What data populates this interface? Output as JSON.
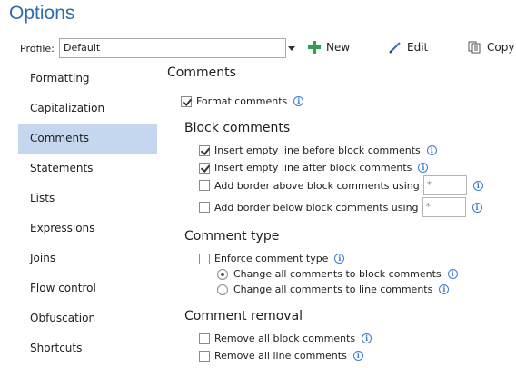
{
  "window": {
    "title": "Options"
  },
  "profile": {
    "label": "Profile:",
    "value": "Default"
  },
  "toolbar": {
    "new_label": "New",
    "edit_label": "Edit",
    "copy_label": "Copy"
  },
  "nav": {
    "items": [
      {
        "label": "Formatting"
      },
      {
        "label": "Capitalization"
      },
      {
        "label": "Comments",
        "selected": true
      },
      {
        "label": "Statements"
      },
      {
        "label": "Lists"
      },
      {
        "label": "Expressions"
      },
      {
        "label": "Joins"
      },
      {
        "label": "Flow control"
      },
      {
        "label": "Obfuscation"
      },
      {
        "label": "Shortcuts"
      }
    ]
  },
  "main": {
    "heading": "Comments",
    "format_comments": {
      "label": "Format comments",
      "checked": true
    },
    "block_comments": {
      "heading": "Block comments",
      "insert_before": {
        "label": "Insert empty line before block comments",
        "checked": true
      },
      "insert_after": {
        "label": "Insert empty line after block comments",
        "checked": true
      },
      "border_above": {
        "label": "Add border above block comments using",
        "checked": false,
        "value": "*"
      },
      "border_below": {
        "label": "Add border below block comments using",
        "checked": false,
        "value": "*"
      }
    },
    "comment_type": {
      "heading": "Comment type",
      "enforce": {
        "label": "Enforce comment type",
        "checked": false
      },
      "to_block": {
        "label": "Change all comments to block comments",
        "selected": true
      },
      "to_line": {
        "label": "Change all comments to line comments",
        "selected": false
      }
    },
    "comment_removal": {
      "heading": "Comment removal",
      "remove_block": {
        "label": "Remove all block comments",
        "checked": false
      },
      "remove_line": {
        "label": "Remove all line comments",
        "checked": false
      }
    }
  },
  "colors": {
    "title": "#2e6cae",
    "selected_nav": "#c5d7ee",
    "new_icon": "#2e9e4f",
    "info_icon": "#3a7bd5"
  }
}
